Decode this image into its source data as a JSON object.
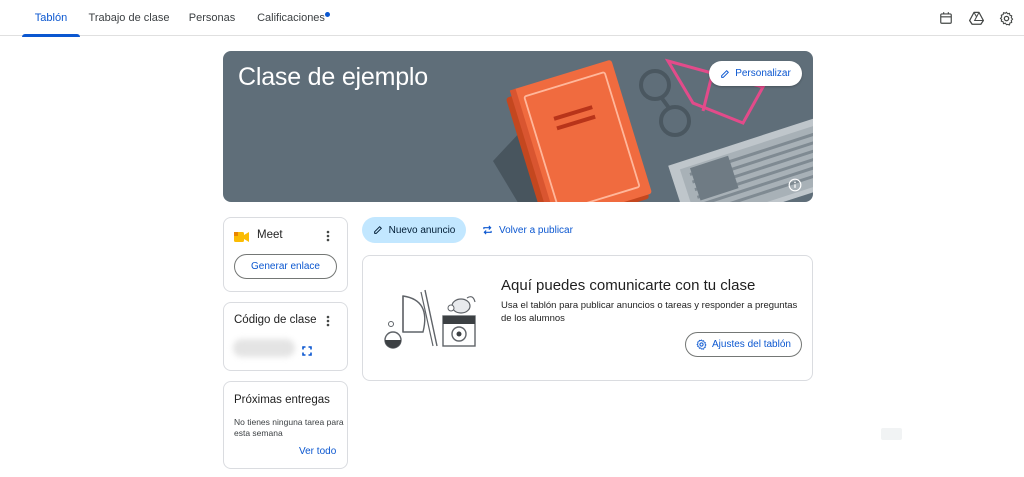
{
  "nav": {
    "tabs": [
      {
        "label": "Tablón",
        "active": true
      },
      {
        "label": "Trabajo de clase",
        "active": false
      },
      {
        "label": "Personas",
        "active": false
      },
      {
        "label": "Calificaciones",
        "active": false,
        "has_dot": true
      }
    ],
    "icons": [
      "calendar-icon",
      "drive-icon",
      "settings-icon"
    ]
  },
  "banner": {
    "title": "Clase de ejemplo",
    "customize_label": "Personalizar",
    "background_color": "#5f6e79"
  },
  "meet": {
    "title": "Meet",
    "generate_label": "Generar enlace"
  },
  "class_code": {
    "title": "Código de clase"
  },
  "upcoming": {
    "title": "Próximas entregas",
    "empty_text": "No tienes ninguna tarea para esta semana",
    "view_all_label": "Ver todo"
  },
  "stream": {
    "new_announcement_label": "Nuevo anuncio",
    "repost_label": "Volver a publicar",
    "info_heading": "Aquí puedes comunicarte con tu clase",
    "info_description": "Usa el tablón para publicar anuncios o tareas y responder a preguntas de los alumnos",
    "settings_label": "Ajustes del tablón"
  },
  "colors": {
    "accent": "#0b57d0",
    "tonal_button": "#c2e7ff",
    "border": "#dadce0",
    "book": "#e8683f"
  }
}
